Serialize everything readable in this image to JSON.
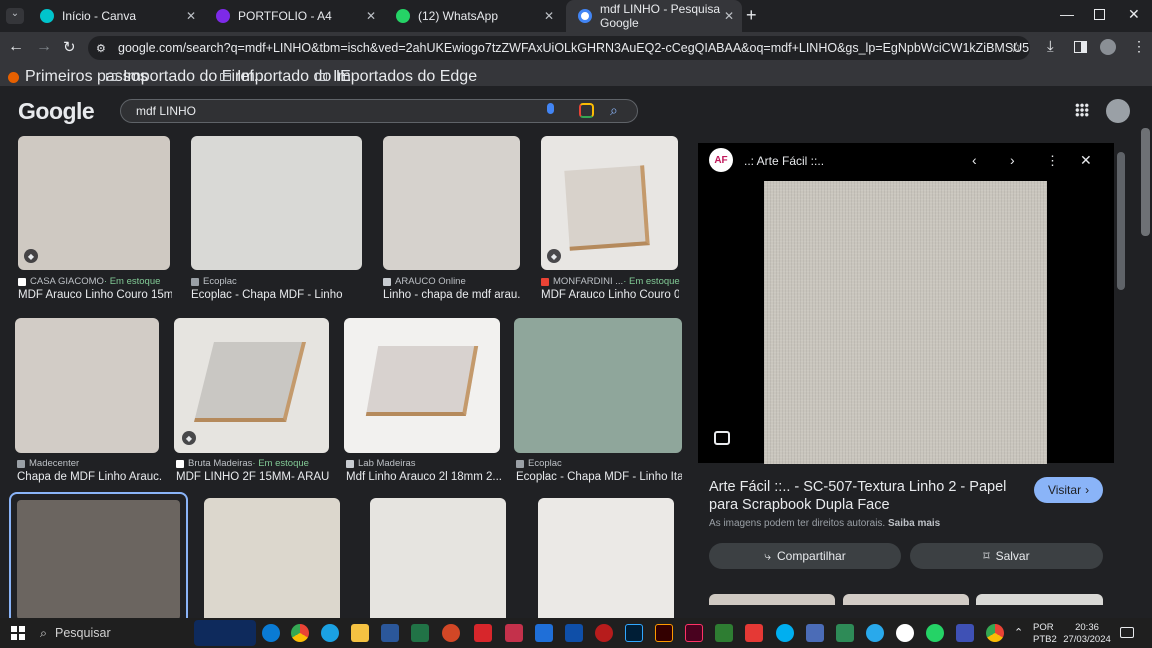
{
  "tabs": [
    {
      "title": "Início - Canva",
      "color": "#00c4cc"
    },
    {
      "title": "PORTFOLIO - A4",
      "color": "#7d2ae8"
    },
    {
      "title": "(12) WhatsApp",
      "color": "#25d366"
    },
    {
      "title": "mdf LINHO - Pesquisa Google",
      "color": "#4285f4"
    }
  ],
  "url": "google.com/search?q=mdf+LINHO&tbm=isch&ved=2ahUKEwiogo7tzZWFAxUiOLkGHRN3AuEQ2-cCegQIABAA&oq=mdf+LINHO&gs_lp=EgNpbWciCW1kZiBMSU5IT2IFEAAYgAQyBRAAGIE...",
  "bookmarks": [
    "Primeiros passos",
    "Importado do Firef...",
    "Importado do IE",
    "Importados do Edge"
  ],
  "google_logo": "Google",
  "search_query": "mdf LINHO",
  "results": [
    {
      "source": "CASA GIACOMO",
      "stock": " · Em estoque",
      "title": "MDF Arauco Linho Couro 15m...",
      "color": "#cfc9c2",
      "badge": true
    },
    {
      "source": "Ecoplac",
      "stock": "",
      "title": "Ecoplac - Chapa MDF - Linho",
      "color": "#d9d9d6",
      "badge": false
    },
    {
      "source": "ARAUCO Online",
      "stock": "",
      "title": "Linho - chapa de mdf arau...",
      "color": "#d6d2cd",
      "badge": false
    },
    {
      "source": "MONFARDINI ...",
      "stock": " · Em estoque",
      "title": "MDF Arauco Linho Couro 0...",
      "color": "#e8e6e3",
      "badge": true
    },
    {
      "source": "Madecenter",
      "stock": "",
      "title": "Chapa de MDF Linho Arauc...",
      "color": "#d2ccc6",
      "badge": false
    },
    {
      "source": "Bruta Madeiras",
      "stock": " · Em estoque",
      "title": "MDF LINHO 2F 15MM- ARAU...",
      "color": "#e6e4e0",
      "badge": true
    },
    {
      "source": "Lab Madeiras",
      "stock": "",
      "title": "Mdf Linho Arauco 2l 18mm 2...",
      "color": "#e4e2de",
      "badge": false
    },
    {
      "source": "Ecoplac",
      "stock": "",
      "title": "Ecoplac - Chapa MDF - Linho Ita...",
      "color": "#8fa69b",
      "badge": false
    }
  ],
  "panel": {
    "site": "..: Arte Fácil ::..",
    "title": "Arte Fácil ::.. - SC-507-Textura Linho 2 - Papel para Scrapbook Dupla Face",
    "rights": "As imagens podem ter direitos autorais.",
    "more": "Saiba mais",
    "visit": "Visitar",
    "share": "Compartilhar",
    "save": "Salvar"
  },
  "taskbar": {
    "search": "Pesquisar",
    "lang": "POR",
    "layout": "PTB2",
    "time": "20:36",
    "date": "27/03/2024"
  }
}
